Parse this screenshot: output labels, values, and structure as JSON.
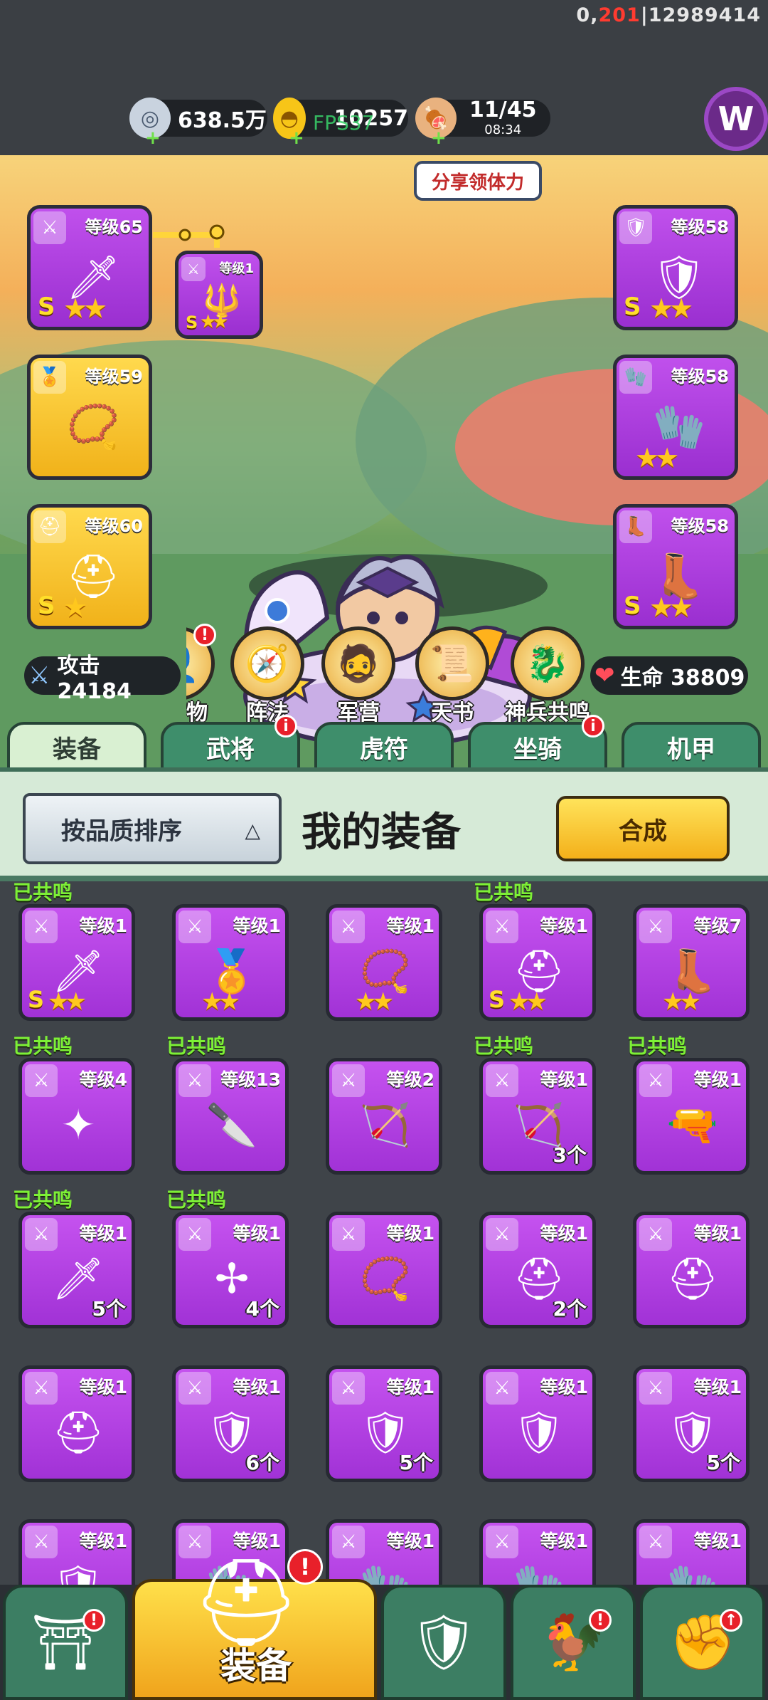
{
  "status": {
    "prefix": "0,",
    "highlight": "201",
    "suffix": "|12989414"
  },
  "resources": {
    "silver": {
      "value": "638.5万",
      "icon": "silver-coin-icon"
    },
    "gold": {
      "value": "10257",
      "icon": "gold-ingot-icon"
    },
    "stamina": {
      "value": "11/45",
      "timer": "08:34",
      "icon": "meat-icon"
    }
  },
  "fps_overlay": "FPS37",
  "share_button": "分享领体力",
  "stats": {
    "attack": "攻击 24184",
    "hp": "生命 38809"
  },
  "features": [
    {
      "label": "物",
      "badge": "!"
    },
    {
      "label": "阵法",
      "badge": ""
    },
    {
      "label": "军营",
      "badge": ""
    },
    {
      "label": "天书",
      "badge": ""
    },
    {
      "label": "神兵共鸣",
      "badge": ""
    }
  ],
  "equipped": {
    "left": [
      {
        "level": "等级65",
        "grade": "S",
        "stars": "★★",
        "type": "sword"
      },
      {
        "level": "等级59",
        "grade": "",
        "stars": "",
        "type": "medal"
      },
      {
        "level": "等级60",
        "grade": "S",
        "stars": "★",
        "type": "helmet"
      }
    ],
    "linked": {
      "level": "等级1",
      "grade": "S",
      "stars": "★★"
    },
    "right": [
      {
        "level": "等级58",
        "grade": "S",
        "stars": "★★",
        "type": "armor"
      },
      {
        "level": "等级58",
        "grade": "",
        "stars": "★★",
        "type": "bracer"
      },
      {
        "level": "等级58",
        "grade": "S",
        "stars": "★★",
        "type": "boots"
      }
    ]
  },
  "tabs": [
    {
      "label": "装备",
      "active": true,
      "badge": ""
    },
    {
      "label": "武将",
      "active": false,
      "badge": "i"
    },
    {
      "label": "虎符",
      "active": false,
      "badge": ""
    },
    {
      "label": "坐骑",
      "active": false,
      "badge": "i"
    },
    {
      "label": "机甲",
      "active": false,
      "badge": ""
    }
  ],
  "panel": {
    "sort_label": "按品质排序",
    "title": "我的装备",
    "synth_label": "合成"
  },
  "inventory": [
    {
      "tag": "已共鸣",
      "level": "等级1",
      "grade": "S",
      "stars": "★★",
      "count": "",
      "art": "🗡"
    },
    {
      "tag": "",
      "level": "等级1",
      "grade": "",
      "stars": "★★",
      "count": "",
      "art": "🏅"
    },
    {
      "tag": "",
      "level": "等级1",
      "grade": "",
      "stars": "★★",
      "count": "",
      "art": "📿"
    },
    {
      "tag": "已共鸣",
      "level": "等级1",
      "grade": "S",
      "stars": "★★",
      "count": "",
      "art": "⛑"
    },
    {
      "tag": "",
      "level": "等级7",
      "grade": "",
      "stars": "★★",
      "count": "",
      "art": "👢"
    },
    {
      "tag": "已共鸣",
      "level": "等级4",
      "grade": "",
      "stars": "",
      "count": "",
      "art": "✦"
    },
    {
      "tag": "已共鸣",
      "level": "等级13",
      "grade": "",
      "stars": "",
      "count": "",
      "art": "🔪"
    },
    {
      "tag": "",
      "level": "等级2",
      "grade": "",
      "stars": "",
      "count": "",
      "art": "🏹"
    },
    {
      "tag": "已共鸣",
      "level": "等级1",
      "grade": "",
      "stars": "",
      "count": "3个",
      "art": "🏹"
    },
    {
      "tag": "已共鸣",
      "level": "等级1",
      "grade": "",
      "stars": "",
      "count": "",
      "art": "🔫"
    },
    {
      "tag": "已共鸣",
      "level": "等级1",
      "grade": "",
      "stars": "",
      "count": "5个",
      "art": "🗡"
    },
    {
      "tag": "已共鸣",
      "level": "等级1",
      "grade": "",
      "stars": "",
      "count": "4个",
      "art": "✢"
    },
    {
      "tag": "",
      "level": "等级1",
      "grade": "",
      "stars": "",
      "count": "",
      "art": "📿"
    },
    {
      "tag": "",
      "level": "等级1",
      "grade": "",
      "stars": "",
      "count": "2个",
      "art": "⛑"
    },
    {
      "tag": "",
      "level": "等级1",
      "grade": "",
      "stars": "",
      "count": "",
      "art": "⛑"
    },
    {
      "tag": "",
      "level": "等级1",
      "grade": "",
      "stars": "",
      "count": "",
      "art": "⛑"
    },
    {
      "tag": "",
      "level": "等级1",
      "grade": "",
      "stars": "",
      "count": "6个",
      "art": "🛡"
    },
    {
      "tag": "",
      "level": "等级1",
      "grade": "",
      "stars": "",
      "count": "5个",
      "art": "🛡"
    },
    {
      "tag": "",
      "level": "等级1",
      "grade": "",
      "stars": "",
      "count": "",
      "art": "🛡"
    },
    {
      "tag": "",
      "level": "等级1",
      "grade": "",
      "stars": "",
      "count": "5个",
      "art": "🛡"
    },
    {
      "tag": "",
      "level": "等级1",
      "grade": "",
      "stars": "",
      "count": "",
      "art": "🛡"
    },
    {
      "tag": "",
      "level": "等级1",
      "grade": "",
      "stars": "",
      "count": "",
      "art": "🧤"
    },
    {
      "tag": "",
      "level": "等级1",
      "grade": "",
      "stars": "",
      "count": "",
      "art": "🧤"
    },
    {
      "tag": "",
      "level": "等级1",
      "grade": "",
      "stars": "",
      "count": "",
      "art": "🧤"
    },
    {
      "tag": "",
      "level": "等级1",
      "grade": "",
      "stars": "",
      "count": "",
      "art": "🧤"
    }
  ],
  "bottom_nav": [
    {
      "id": "shop",
      "label": "",
      "badge": "!"
    },
    {
      "id": "equip",
      "label": "装备",
      "badge": "!"
    },
    {
      "id": "battle",
      "label": "",
      "badge": ""
    },
    {
      "id": "pet",
      "label": "",
      "badge": "!"
    },
    {
      "id": "upgrade",
      "label": "",
      "badge": "↑"
    }
  ],
  "colors": {
    "accent_purple": "#a132d6",
    "resonance_green": "#7df036",
    "tab_green": "#3e8e6b",
    "synth_yellow": "#f3b01a"
  }
}
